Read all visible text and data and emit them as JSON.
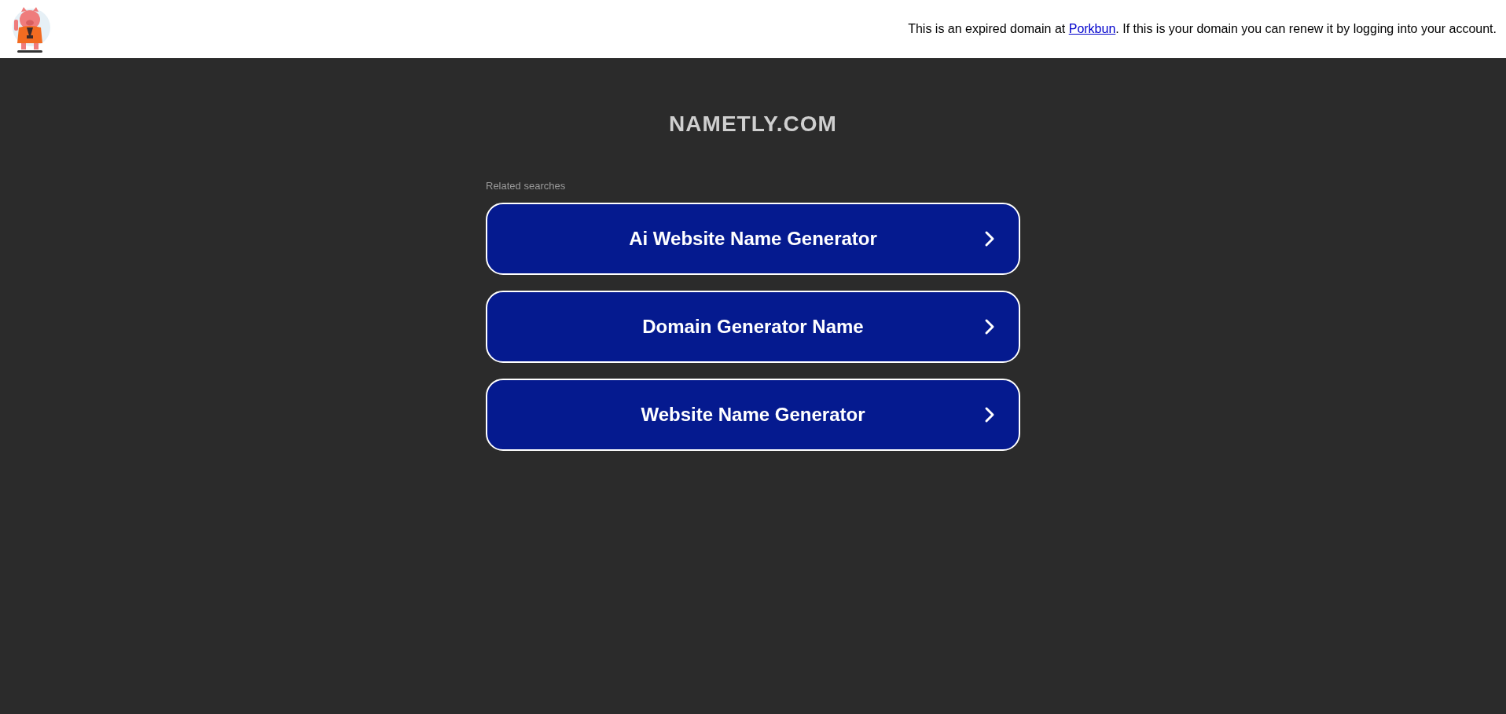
{
  "header": {
    "notice": {
      "before": "This is an expired domain at ",
      "link": "Porkbun",
      "after": ". If this is your domain you can renew it by logging into your account."
    }
  },
  "title": "NAMETLY.COM",
  "related": {
    "label": "Related searches",
    "items": [
      {
        "label": "Ai Website Name Generator"
      },
      {
        "label": "Domain Generator Name"
      },
      {
        "label": "Website Name Generator"
      }
    ]
  }
}
